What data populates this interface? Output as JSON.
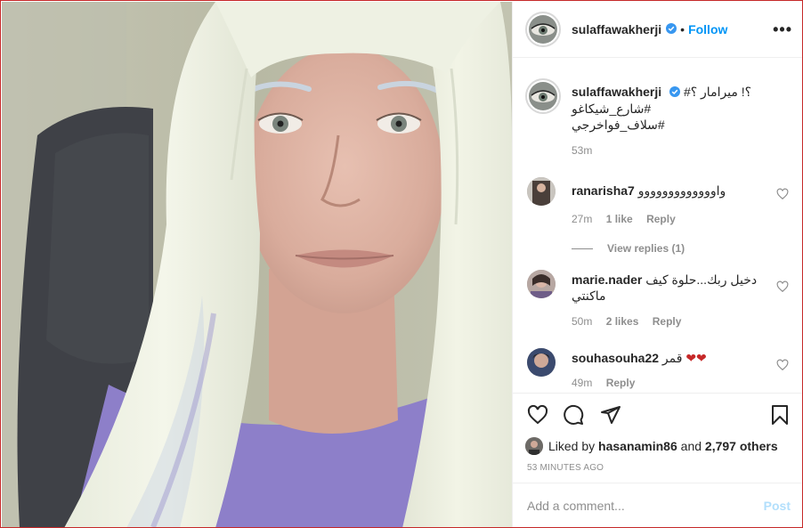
{
  "header": {
    "username": "sulaffawakherji",
    "dot": "•",
    "follow_label": "Follow",
    "more_label": "•••"
  },
  "caption": {
    "username": "sulaffawakherji",
    "line1": "؟! ميرامار ؟#",
    "line2": "#شارع_شيكاغو",
    "line3": "#سلاف_فواخرجي",
    "time": "53m"
  },
  "comments": [
    {
      "username": "ranarisha7",
      "text": "واووووووووووووو",
      "time": "27m",
      "likes": "1 like",
      "reply": "Reply",
      "view_replies": "View replies (1)"
    },
    {
      "username": "marie.nader",
      "text": "دخيل ربك...حلوة كيف",
      "text2": "ماكنتي",
      "time": "50m",
      "likes": "2 likes",
      "reply": "Reply"
    },
    {
      "username": "souhasouha22",
      "text": "قمر",
      "hearts": "❤❤",
      "time": "49m",
      "reply": "Reply"
    }
  ],
  "likes": {
    "prefix": "Liked by",
    "user": "hasanamin86",
    "and": "and",
    "others": "2,797 others"
  },
  "timeago": "53 MINUTES AGO",
  "add_comment": {
    "placeholder": "Add a comment...",
    "post_label": "Post"
  },
  "colors": {
    "accent": "#0095f6",
    "post_disabled": "#b2dffc",
    "muted": "#8e8e8e",
    "heart": "#c62828"
  }
}
